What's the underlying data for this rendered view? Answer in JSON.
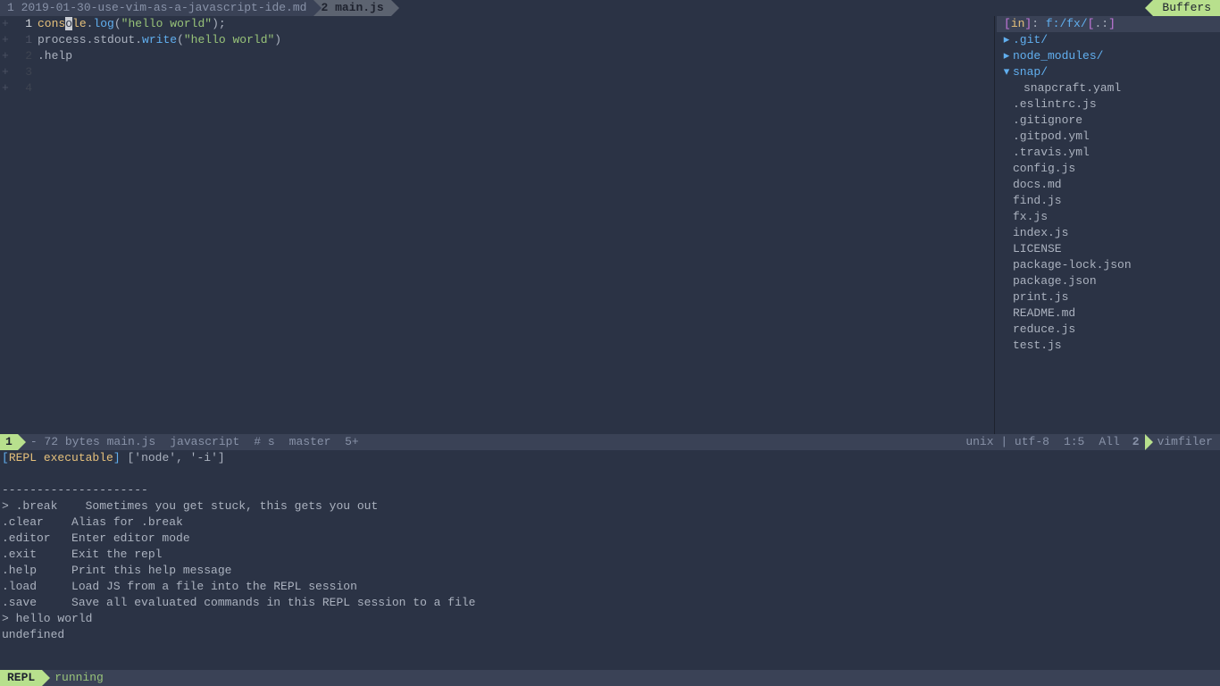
{
  "tabs": [
    {
      "num": "1",
      "label": "2019-01-30-use-vim-as-a-javascript-ide.md",
      "active": false
    },
    {
      "num": "2",
      "label": "main.js",
      "active": true
    }
  ],
  "buffers_label": "Buffers",
  "code_lines": [
    {
      "sign": "+",
      "num": "1",
      "current": true,
      "parts": [
        {
          "t": "cons",
          "c": "kw"
        },
        {
          "t": "o",
          "c": "cursor"
        },
        {
          "t": "le",
          "c": "kw"
        },
        {
          "t": ".",
          "c": "punc"
        },
        {
          "t": "log",
          "c": "fn"
        },
        {
          "t": "(",
          "c": "punc"
        },
        {
          "t": "\"hello world\"",
          "c": "str"
        },
        {
          "t": ");",
          "c": "punc"
        }
      ]
    },
    {
      "sign": "+",
      "num": "1",
      "current": false,
      "parts": [
        {
          "t": "process",
          "c": "plain"
        },
        {
          "t": ".",
          "c": "punc"
        },
        {
          "t": "stdout",
          "c": "plain"
        },
        {
          "t": ".",
          "c": "punc"
        },
        {
          "t": "write",
          "c": "fn"
        },
        {
          "t": "(",
          "c": "punc"
        },
        {
          "t": "\"hello world\"",
          "c": "str"
        },
        {
          "t": ")",
          "c": "punc"
        }
      ]
    },
    {
      "sign": "+",
      "num": "2",
      "current": false,
      "dim": true,
      "parts": [
        {
          "t": ".help",
          "c": "plain"
        }
      ]
    },
    {
      "sign": "+",
      "num": "3",
      "current": false,
      "dim": true,
      "parts": []
    },
    {
      "sign": "+",
      "num": "4",
      "current": false,
      "dim": true,
      "parts": []
    }
  ],
  "filetree": {
    "header_in": "in",
    "header_path": "f:/fx/",
    "header_suffix": ".:",
    "items": [
      {
        "indent": 0,
        "icon": "▸",
        "type": "dir",
        "name": ".git/"
      },
      {
        "indent": 0,
        "icon": "▸",
        "type": "dir",
        "name": "node_modules/"
      },
      {
        "indent": 0,
        "icon": "▾",
        "type": "dir",
        "name": "snap/"
      },
      {
        "indent": 1,
        "icon": "",
        "type": "file",
        "name": "snapcraft.yaml"
      },
      {
        "indent": 0,
        "icon": "",
        "type": "file",
        "name": ".eslintrc.js"
      },
      {
        "indent": 0,
        "icon": "",
        "type": "file",
        "name": ".gitignore"
      },
      {
        "indent": 0,
        "icon": "",
        "type": "file",
        "name": ".gitpod.yml"
      },
      {
        "indent": 0,
        "icon": "",
        "type": "file",
        "name": ".travis.yml"
      },
      {
        "indent": 0,
        "icon": "",
        "type": "file",
        "name": "config.js"
      },
      {
        "indent": 0,
        "icon": "",
        "type": "file",
        "name": "docs.md"
      },
      {
        "indent": 0,
        "icon": "",
        "type": "file",
        "name": "find.js"
      },
      {
        "indent": 0,
        "icon": "",
        "type": "file",
        "name": "fx.js"
      },
      {
        "indent": 0,
        "icon": "",
        "type": "file",
        "name": "index.js"
      },
      {
        "indent": 0,
        "icon": "",
        "type": "file",
        "name": "LICENSE"
      },
      {
        "indent": 0,
        "icon": "",
        "type": "file",
        "name": "package-lock.json"
      },
      {
        "indent": 0,
        "icon": "",
        "type": "file",
        "name": "package.json"
      },
      {
        "indent": 0,
        "icon": "",
        "type": "file",
        "name": "print.js"
      },
      {
        "indent": 0,
        "icon": "",
        "type": "file",
        "name": "README.md"
      },
      {
        "indent": 0,
        "icon": "",
        "type": "file",
        "name": "reduce.js"
      },
      {
        "indent": 0,
        "icon": "",
        "type": "file",
        "name": "test.js"
      }
    ]
  },
  "statusbar_left": {
    "window": "1",
    "fileinfo": "- 72 bytes main.js",
    "filetype": "javascript",
    "vcs_prefix": "# s",
    "branch": "master",
    "ahead": "5+"
  },
  "statusbar_right": {
    "format": "unix | utf-8",
    "pos": "1:5",
    "pct": "All",
    "window2": "2",
    "mode": "vimfiler"
  },
  "repl": {
    "exec_label": "REPL executable",
    "exec_cmd": "['node', '-i']",
    "lines": [
      "",
      "---------------------",
      "> .break    Sometimes you get stuck, this gets you out",
      ".clear    Alias for .break",
      ".editor   Enter editor mode",
      ".exit     Exit the repl",
      ".help     Print this help message",
      ".load     Load JS from a file into the REPL session",
      ".save     Save all evaluated commands in this REPL session to a file",
      "> hello world",
      "undefined"
    ],
    "status_label": "REPL",
    "status_text": "running"
  }
}
